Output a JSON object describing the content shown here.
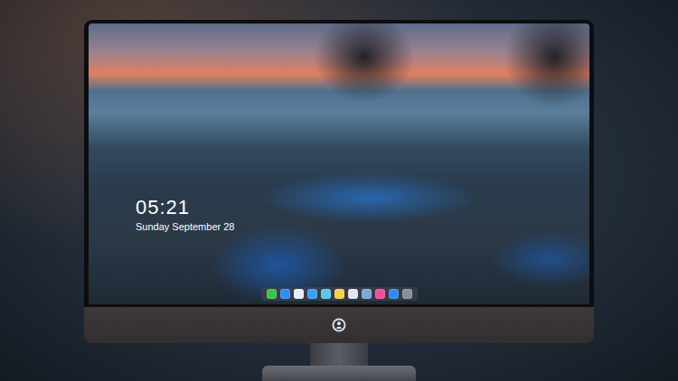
{
  "lock_screen": {
    "time": "05:21",
    "date": "Sunday September 28"
  },
  "dock": {
    "apps": [
      {
        "color": "#3cc24a"
      },
      {
        "color": "#2f8cf0"
      },
      {
        "color": "#e8eef5"
      },
      {
        "color": "#3a9ff2"
      },
      {
        "color": "#5ac8e8"
      },
      {
        "color": "#f5d04a"
      },
      {
        "color": "#dfe6ee"
      },
      {
        "color": "#7fa8d8"
      },
      {
        "color": "#f0509a"
      },
      {
        "color": "#2f8cf0"
      },
      {
        "color": "#8a8f98"
      }
    ]
  }
}
